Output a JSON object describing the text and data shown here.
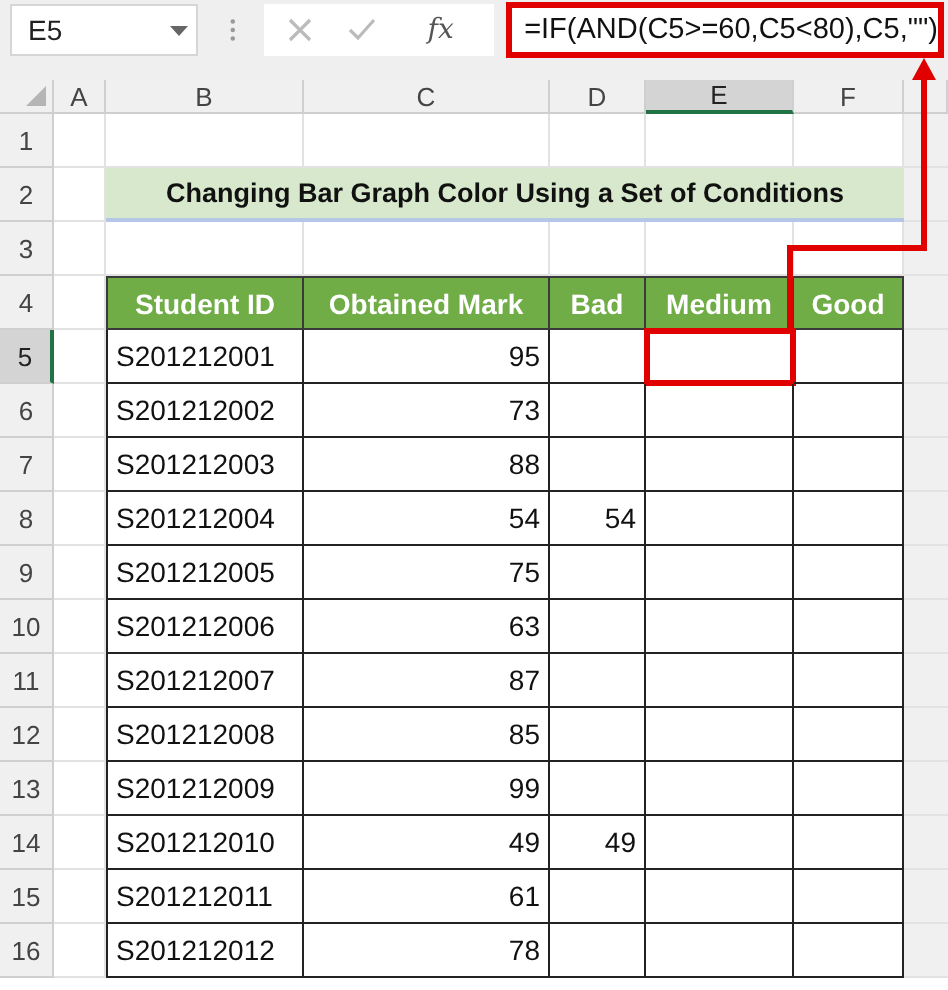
{
  "formula_bar": {
    "name_box": "E5",
    "function_label": "fx",
    "formula": "=IF(AND(C5>=60,C5<80),C5,\"\")"
  },
  "columns": [
    {
      "label": "A",
      "selected": false
    },
    {
      "label": "B",
      "selected": false
    },
    {
      "label": "C",
      "selected": false
    },
    {
      "label": "D",
      "selected": false
    },
    {
      "label": "E",
      "selected": true
    },
    {
      "label": "F",
      "selected": false
    }
  ],
  "rows": [
    {
      "number": "1",
      "selected": false
    },
    {
      "number": "2",
      "selected": false
    },
    {
      "number": "3",
      "selected": false
    },
    {
      "number": "4",
      "selected": false
    },
    {
      "number": "5",
      "selected": true
    },
    {
      "number": "6",
      "selected": false
    },
    {
      "number": "7",
      "selected": false
    },
    {
      "number": "8",
      "selected": false
    },
    {
      "number": "9",
      "selected": false
    },
    {
      "number": "10",
      "selected": false
    },
    {
      "number": "11",
      "selected": false
    },
    {
      "number": "12",
      "selected": false
    },
    {
      "number": "13",
      "selected": false
    },
    {
      "number": "14",
      "selected": false
    },
    {
      "number": "15",
      "selected": false
    },
    {
      "number": "16",
      "selected": false
    }
  ],
  "title": "Changing Bar Graph Color Using a Set of Conditions",
  "table": {
    "columns": [
      "Student ID",
      "Obtained Mark",
      "Bad",
      "Medium",
      "Good"
    ],
    "rows": [
      {
        "student_id": "S201212001",
        "obtained_mark": "95",
        "medium_highlighted": true
      },
      {
        "student_id": "S201212002",
        "obtained_mark": "73",
        "medium_highlighted": false
      },
      {
        "student_id": "S201212003",
        "obtained_mark": "88",
        "medium_highlighted": false
      },
      {
        "student_id": "S201212004",
        "obtained_mark": "54",
        "bad": "54",
        "medium_highlighted": false
      },
      {
        "student_id": "S201212005",
        "obtained_mark": "75",
        "medium_highlighted": false
      },
      {
        "student_id": "S201212006",
        "obtained_mark": "63",
        "medium_highlighted": false
      },
      {
        "student_id": "S201212007",
        "obtained_mark": "87",
        "medium_highlighted": false
      },
      {
        "student_id": "S201212008",
        "obtained_mark": "85",
        "medium_highlighted": false
      },
      {
        "student_id": "S201212009",
        "obtained_mark": "99",
        "medium_highlighted": false
      },
      {
        "student_id": "S201212010",
        "obtained_mark": "49",
        "bad": "49",
        "medium_highlighted": false
      },
      {
        "student_id": "S201212011",
        "obtained_mark": "61",
        "medium_highlighted": false
      },
      {
        "student_id": "S201212012",
        "obtained_mark": "78",
        "medium_highlighted": false
      }
    ]
  }
}
